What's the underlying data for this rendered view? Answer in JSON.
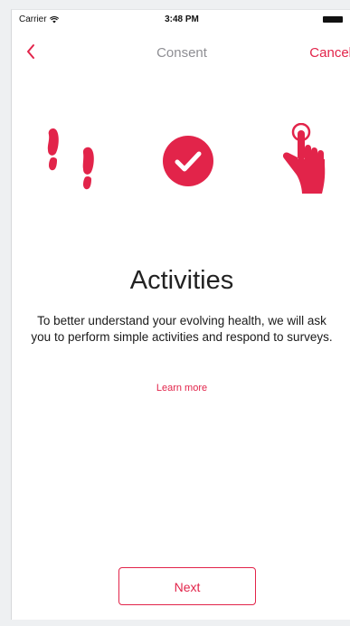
{
  "status_bar": {
    "carrier": "Carrier",
    "wifi_icon": "wifi-icon",
    "time": "3:48 PM",
    "battery_icon": "battery-icon"
  },
  "nav": {
    "back_icon": "chevron-left-icon",
    "title": "Consent",
    "cancel_label": "Cancel"
  },
  "illustration": {
    "icons": [
      "footsteps-icon",
      "checkmark-circle-icon",
      "tap-hand-icon"
    ]
  },
  "content": {
    "headline": "Activities",
    "body": "To better understand your evolving health, we will ask you to perform simple activities and respond to surveys.",
    "learn_more_label": "Learn more"
  },
  "footer": {
    "next_label": "Next"
  },
  "colors": {
    "accent": "#e2244a",
    "title_gray": "#8e8e93",
    "text": "#1a1a1a"
  }
}
